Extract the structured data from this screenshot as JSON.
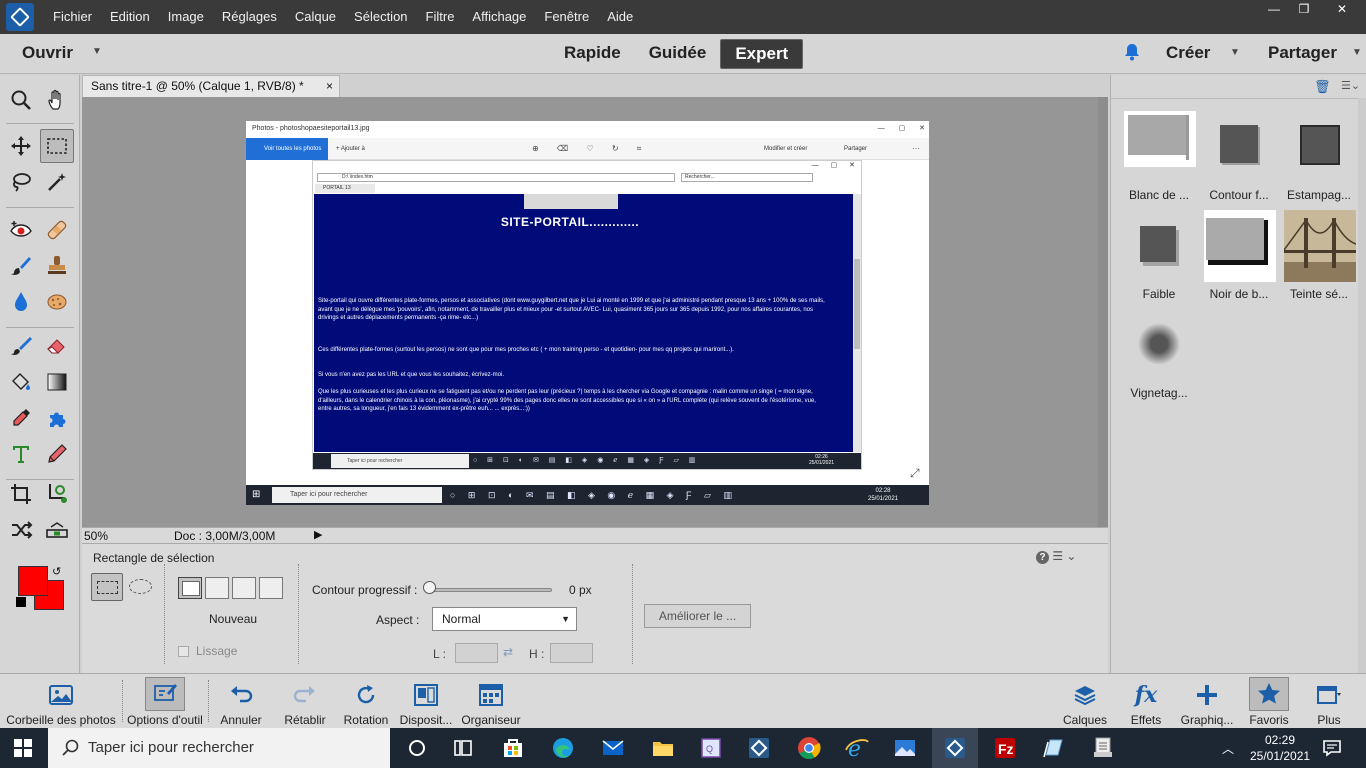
{
  "menu": {
    "items": [
      "Fichier",
      "Edition",
      "Image",
      "Réglages",
      "Calque",
      "Sélection",
      "Filtre",
      "Affichage",
      "Fenêtre",
      "Aide"
    ],
    "window_controls": [
      "—",
      "❐",
      "✕"
    ]
  },
  "modebar": {
    "open_label": "Ouvrir",
    "tabs": [
      {
        "label": "Rapide",
        "active": false
      },
      {
        "label": "Guidée",
        "active": false
      },
      {
        "label": "Expert",
        "active": true
      }
    ],
    "create_label": "Créer",
    "share_label": "Partager"
  },
  "document": {
    "tab_title": "Sans titre-1 @ 50% (Calque 1, RVB/8) *",
    "close": "×",
    "zoom": "50%",
    "doc_size": "Doc : 3,00M/3,00M"
  },
  "photo_app": {
    "title": "Photos - photoshopaesiteportail13.jpg",
    "window_controls": "— ▢ ✕",
    "see_all": "Voir toutes les photos",
    "add_to": "Ajouter à",
    "toolbar_icons": "⊕ ⌫ ♡ ↻ ⌗",
    "edit_create": "Modifier et créer",
    "share": "Partager",
    "more": "···",
    "browser": {
      "window_controls": "— ▢ ✕",
      "address": "D:\\                               \\index.htm",
      "search_placeholder": "Rechercher...",
      "tab_label": "PORTAIL 13",
      "page_title": "SITE-PORTAIL.............",
      "paragraphs": [
        "Site-portail qui ouvre différentes plate-formes, persos et associatives (dont www.guygilbert.net que je Lui ai monté en 1999 et que j'ai administré pendant presque 13 ans + 100% de ses mails, avant que je ne délègue mes 'pouvoirs', afin, notamment, de travailler plus et mieux pour -et surtout AVEC- Lui, quasiment 365 jours sur 365 depuis 1992, pour nos affaires courantes, nos drivings et autres déplacements permanents -ça rime- etc...)",
        "Ces différentes plate-formes (surtout les persos) ne sont que pour mes proches etc ( + mon training perso - et quotidien- pour mes qq projets qui mariront...).",
        "Si vous n'en avez pas les URL et que vous les souhaitez, écrivez-moi.",
        "Que les plus curieuses et les plus curieux ne se fatiguent pas et/ou ne perdent pas leur (précieux ?) temps à les chercher via Google et compagnie : malin comme un singe ( = mon signe, d'ailleurs, dans le calendrier chinois à la con, pléonasme), j'ai crypté 99% des pages donc elles ne sont accessibles que si « on » a l'URL complète (qui relève souvent de l'ésotérisme, vue, entre autres, sa longueur, j'en fais 13 évidemment ex-prêtre euh... ... exprès...:))"
      ],
      "taskbar_search": "Taper ici pour rechercher",
      "taskbar_icons": "○ ⊞ ⊡ ◐ ✉ ▤ ◧ ◈ ◉ ℯ ▦ ◈ Ƒ ▱ ▥",
      "taskbar_time": "02:26",
      "taskbar_date": "25/01/2021"
    },
    "taskbar_search": "Taper ici pour rechercher",
    "taskbar_icons": "○ ⊞ ⊡ ◐ ✉ ▤ ◧ ◈ ◉ ℯ ▦ ◈ Ƒ ▱ ▥",
    "taskbar_time": "02:28",
    "taskbar_date": "25/01/2021",
    "expand": "⤢"
  },
  "tool_options": {
    "title": "Rectangle de sélection",
    "new_label": "Nouveau",
    "smooth_label": "Lissage",
    "feather_label": "Contour progressif :",
    "feather_value": "0 px",
    "feather_fraction": 0,
    "aspect_label": "Aspect :",
    "aspect_value": "Normal",
    "width_label": "L :",
    "height_label": "H :",
    "refine_label": "Améliorer le ...",
    "help": "?"
  },
  "effects": [
    {
      "label": "Blanc de ..."
    },
    {
      "label": "Contour f..."
    },
    {
      "label": "Estampag..."
    },
    {
      "label": "Faible"
    },
    {
      "label": "Noir de b..."
    },
    {
      "label": "Teinte sé..."
    },
    {
      "label": "Vignetag..."
    }
  ],
  "bottom_bar": {
    "left": [
      {
        "label": "Corbeille des photos"
      },
      {
        "label": "Options d'outil"
      },
      {
        "label": "Annuler"
      },
      {
        "label": "Rétablir"
      },
      {
        "label": "Rotation"
      },
      {
        "label": "Disposit..."
      },
      {
        "label": "Organiseur"
      }
    ],
    "right": [
      {
        "label": "Calques"
      },
      {
        "label": "Effets"
      },
      {
        "label": "Graphiq..."
      },
      {
        "label": "Favoris"
      },
      {
        "label": "Plus"
      }
    ],
    "fx_text": "fx"
  },
  "taskbar": {
    "search_placeholder": "Taper ici pour rechercher",
    "time": "02:29",
    "date": "25/01/2021"
  },
  "colors": {
    "foreground": "#ff0000",
    "background": "#ff0000",
    "accent": "#1c5fa8",
    "page_navy": "#000b7a"
  }
}
